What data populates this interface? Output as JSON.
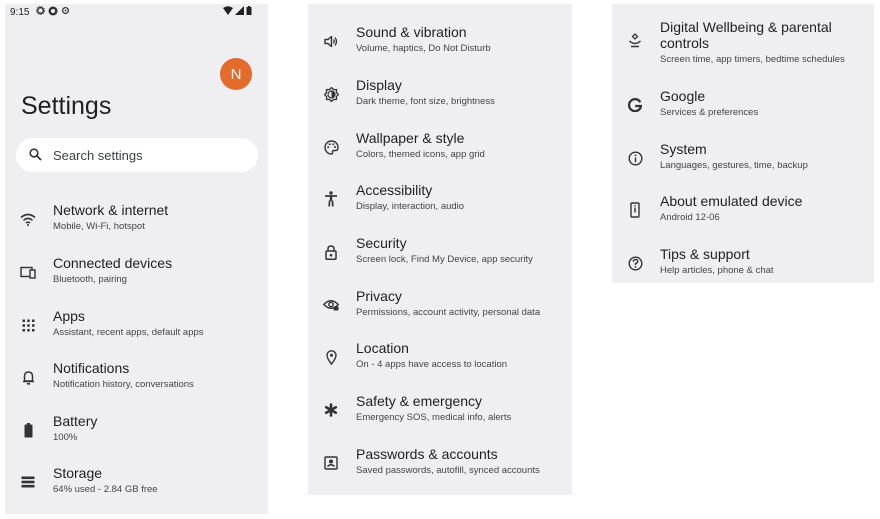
{
  "status_bar": {
    "time": "9:15"
  },
  "profile": {
    "initial": "N",
    "color": "#e36b2c"
  },
  "page_title": "Settings",
  "search": {
    "placeholder": "Search settings"
  },
  "left_items": [
    {
      "icon": "wifi-icon",
      "title": "Network & internet",
      "subtitle": "Mobile, Wi-Fi, hotspot"
    },
    {
      "icon": "connected-devices-icon",
      "title": "Connected devices",
      "subtitle": "Bluetooth, pairing"
    },
    {
      "icon": "apps-grid-icon",
      "title": "Apps",
      "subtitle": "Assistant, recent apps, default apps"
    },
    {
      "icon": "bell-icon",
      "title": "Notifications",
      "subtitle": "Notification history, conversations"
    },
    {
      "icon": "battery-icon",
      "title": "Battery",
      "subtitle": "100%"
    },
    {
      "icon": "storage-icon",
      "title": "Storage",
      "subtitle": "64% used - 2.84 GB free"
    }
  ],
  "middle_items": [
    {
      "icon": "speaker-icon",
      "title": "Sound & vibration",
      "subtitle": "Volume, haptics, Do Not Disturb"
    },
    {
      "icon": "brightness-icon",
      "title": "Display",
      "subtitle": "Dark theme, font size, brightness"
    },
    {
      "icon": "palette-icon",
      "title": "Wallpaper & style",
      "subtitle": "Colors, themed icons, app grid"
    },
    {
      "icon": "accessibility-icon",
      "title": "Accessibility",
      "subtitle": "Display, interaction, audio"
    },
    {
      "icon": "lock-icon",
      "title": "Security",
      "subtitle": "Screen lock, Find My Device, app security"
    },
    {
      "icon": "privacy-eye-icon",
      "title": "Privacy",
      "subtitle": "Permissions, account activity, personal data"
    },
    {
      "icon": "location-pin-icon",
      "title": "Location",
      "subtitle": "On - 4 apps have access to location"
    },
    {
      "icon": "asterisk-icon",
      "title": "Safety & emergency",
      "subtitle": "Emergency SOS, medical info, alerts"
    },
    {
      "icon": "account-box-icon",
      "title": "Passwords & accounts",
      "subtitle": "Saved passwords, autofill, synced accounts"
    }
  ],
  "right_items": [
    {
      "icon": "wellbeing-icon",
      "title": "Digital Wellbeing & parental controls",
      "subtitle": "Screen time, app timers, bedtime schedules"
    },
    {
      "icon": "google-g-icon",
      "title": "Google",
      "subtitle": "Services & preferences"
    },
    {
      "icon": "info-icon",
      "title": "System",
      "subtitle": "Languages, gestures, time, backup"
    },
    {
      "icon": "phone-icon",
      "title": "About emulated device",
      "subtitle": "Android 12-06"
    },
    {
      "icon": "help-icon",
      "title": "Tips & support",
      "subtitle": "Help articles, phone & chat"
    }
  ]
}
